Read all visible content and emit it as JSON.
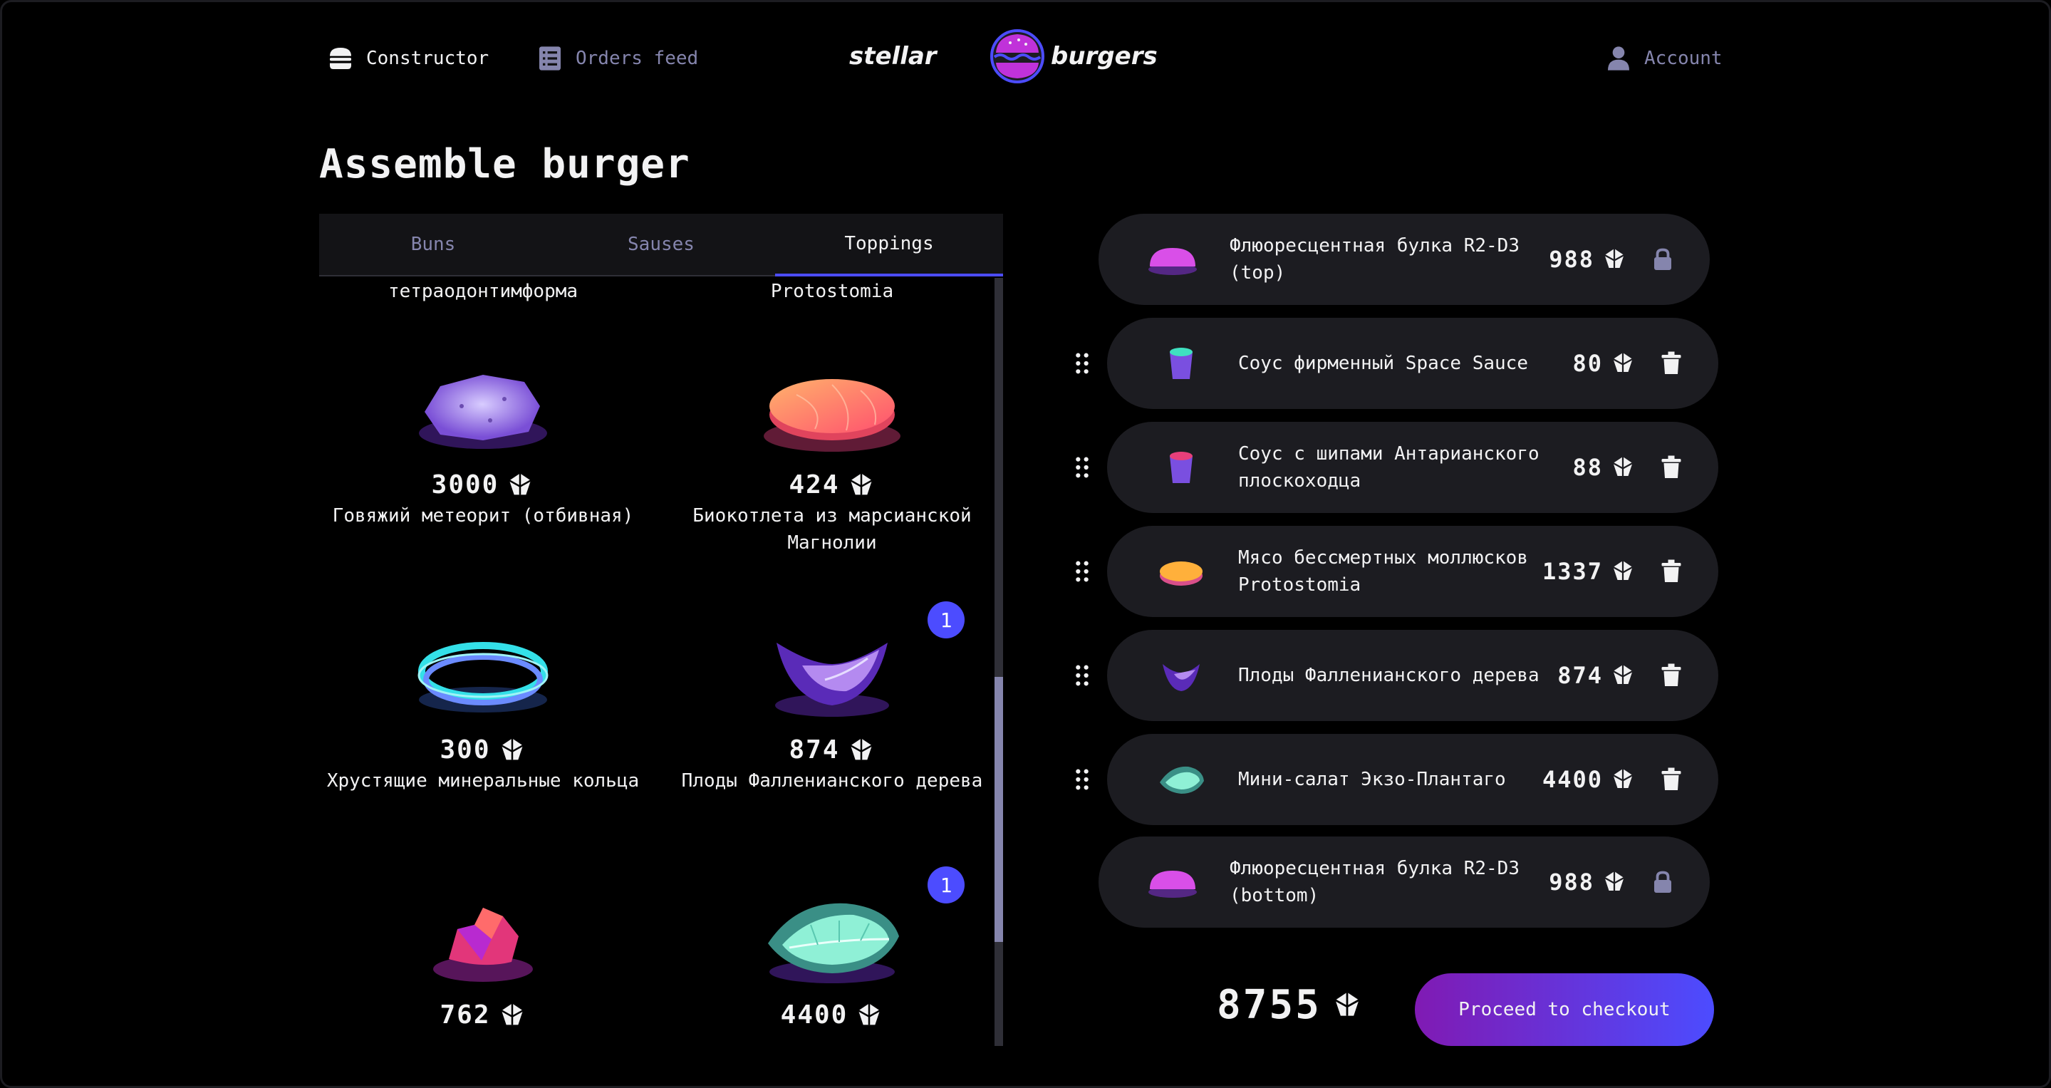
{
  "header": {
    "constructor_label": "Constructor",
    "orders_label": "Orders feed",
    "logo_left": "stellar",
    "logo_right": "burgers",
    "account_label": "Account"
  },
  "page_title": "Assemble burger",
  "tabs": [
    {
      "label": "Buns",
      "active": false
    },
    {
      "label": "Sauses",
      "active": false
    },
    {
      "label": "Toppings",
      "active": true
    }
  ],
  "list_cut_names": [
    "тетраодонтимформа",
    "Protostomia"
  ],
  "ingredients": [
    {
      "price": "3000",
      "name": "Говяжий метеорит (отбивная)",
      "icon": "meteorite-icon",
      "count": ""
    },
    {
      "price": "424",
      "name": "Биокотлета из марсианской Магнолии",
      "icon": "biocutlet-icon",
      "count": ""
    },
    {
      "price": "300",
      "name": "Хрустящие минеральные кольца",
      "icon": "mineral-rings-icon",
      "count": ""
    },
    {
      "price": "874",
      "name": "Плоды Фалленианского дерева",
      "icon": "fallenian-fruit-icon",
      "count": "1"
    },
    {
      "price": "762",
      "name": "",
      "icon": "crystal-icon",
      "count": ""
    },
    {
      "price": "4400",
      "name": "",
      "icon": "leaf-salad-icon",
      "count": "1"
    }
  ],
  "constructor": {
    "top_bun": {
      "name": "Флюоресцентная булка R2-D3 (top)",
      "price": "988"
    },
    "fillings": [
      {
        "name": "Соус фирменный Space Sauce",
        "price": "80"
      },
      {
        "name": "Соус с шипами Антарианского плоскоходца",
        "price": "88"
      },
      {
        "name": "Мясо бессмертных моллюсков Protostomia",
        "price": "1337"
      },
      {
        "name": "Плоды Фалленианского дерева",
        "price": "874"
      },
      {
        "name": "Мини-салат Экзо-Плантаго",
        "price": "4400"
      }
    ],
    "bottom_bun": {
      "name": "Флюоресцентная булка R2-D3 (bottom)",
      "price": "988"
    },
    "total": "8755",
    "checkout_label": "Proceed to checkout"
  },
  "colors": {
    "accent": "#4c4cff",
    "muted": "#8585ad",
    "card": "#1c1c21",
    "gradient_start": "#801ab3"
  }
}
